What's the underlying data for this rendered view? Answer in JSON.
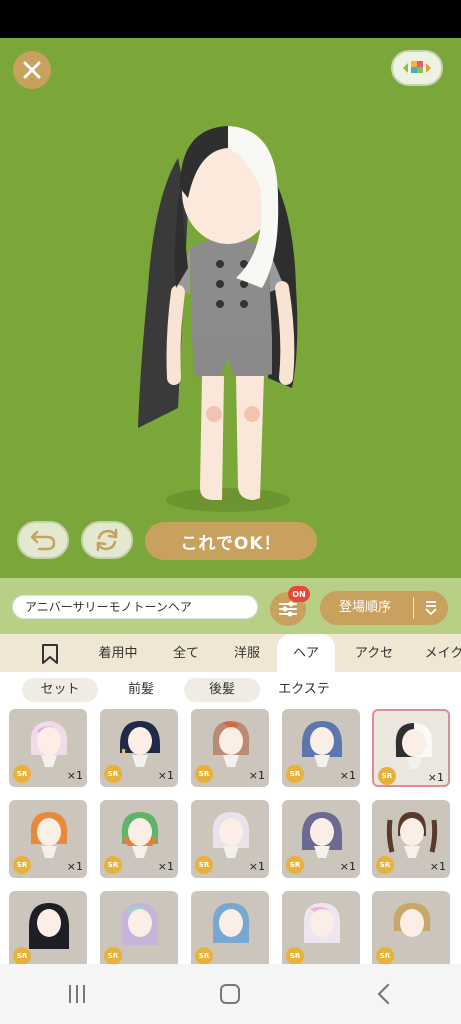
{
  "stage": {
    "ok_label": "これでOK！"
  },
  "search": {
    "current_name": "アニバーサリーモノトーンヘア",
    "filter_badge": "ON",
    "sort_label": "登場順序"
  },
  "categories": [
    "着用中",
    "全て",
    "洋服",
    "ヘア",
    "アクセ",
    "メイク"
  ],
  "active_category": "ヘア",
  "subcategories": [
    "セット",
    "前髪",
    "後髪",
    "エクステ"
  ],
  "items": [
    {
      "rarity": "SR",
      "count": "×1",
      "hair": "pastel-pink-white"
    },
    {
      "rarity": "SR",
      "count": "×1",
      "hair": "navy-gold-tips"
    },
    {
      "rarity": "SR",
      "count": "×1",
      "hair": "auburn-wavy"
    },
    {
      "rarity": "SR",
      "count": "×1",
      "hair": "blue-wavy"
    },
    {
      "rarity": "SR",
      "count": "×1",
      "hair": "monotone-black-white"
    },
    {
      "rarity": "SR",
      "count": "×1",
      "hair": "orange-bob"
    },
    {
      "rarity": "SR",
      "count": "×1",
      "hair": "green-orange"
    },
    {
      "rarity": "SR",
      "count": "×1",
      "hair": "white-long"
    },
    {
      "rarity": "SR",
      "count": "×1",
      "hair": "lavender-long"
    },
    {
      "rarity": "SR",
      "count": "×1",
      "hair": "brown-twintails"
    },
    {
      "rarity": "SR",
      "count": "",
      "hair": "black-long"
    },
    {
      "rarity": "SR",
      "count": "",
      "hair": "pastel-rainbow"
    },
    {
      "rarity": "SR",
      "count": "",
      "hair": "light-blue"
    },
    {
      "rarity": "SR",
      "count": "",
      "hair": "white-pink"
    },
    {
      "rarity": "SR",
      "count": "",
      "hair": "blonde-bob"
    }
  ],
  "colors": {
    "stage_bg": "#7aa63a",
    "accent": "#c9a15f",
    "badge": "#e8473c",
    "selected_border": "#e48a96"
  }
}
